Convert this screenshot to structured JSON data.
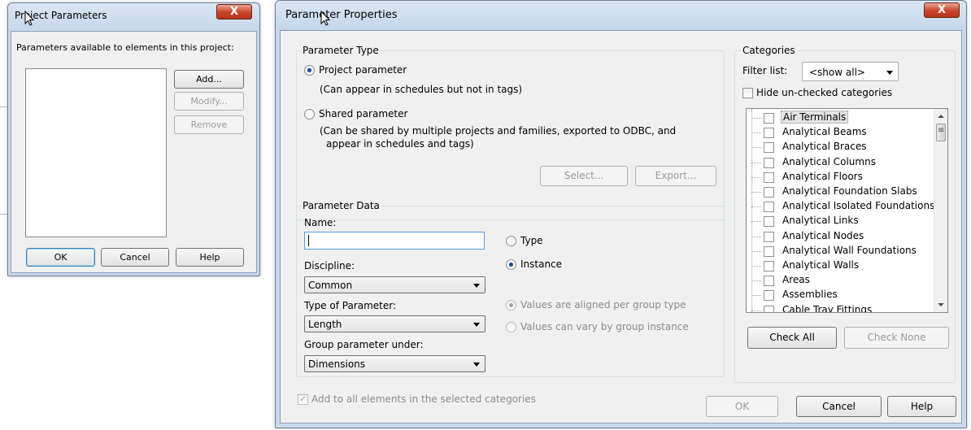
{
  "project_parameters_dialog": {
    "title": "Project Parameters",
    "close_symbol": "X",
    "description": "Parameters available to elements in this project:",
    "add_label": "Add...",
    "modify_label": "Modify...",
    "remove_label": "Remove",
    "ok_label": "OK",
    "cancel_label": "Cancel",
    "help_label": "Help"
  },
  "parameter_properties_dialog": {
    "title": "Parameter Properties",
    "close_symbol": "X",
    "parameter_type": {
      "group_label": "Parameter Type",
      "project_parameter_label": "Project parameter",
      "project_parameter_note": "(Can appear in schedules but not in tags)",
      "shared_parameter_label": "Shared parameter",
      "shared_parameter_note_line1": "(Can be shared by multiple projects and families, exported to ODBC, and",
      "shared_parameter_note_line2": "appear in schedules and tags)",
      "selected": "project",
      "select_label": "Select...",
      "export_label": "Export..."
    },
    "parameter_data": {
      "group_label": "Parameter Data",
      "name_label": "Name:",
      "name_value": "",
      "type_label": "Type",
      "instance_label": "Instance",
      "selected_binding": "instance",
      "discipline_label": "Discipline:",
      "discipline_value": "Common",
      "type_of_parameter_label": "Type of Parameter:",
      "type_of_parameter_value": "Length",
      "group_under_label": "Group parameter under:",
      "group_under_value": "Dimensions",
      "values_aligned_label": "Values are aligned per group type",
      "values_vary_label": "Values can vary by group instance"
    },
    "categories": {
      "group_label": "Categories",
      "filter_label": "Filter list:",
      "filter_value": "<show all>",
      "hide_unchecked_label": "Hide un-checked categories",
      "items": [
        "Air Terminals",
        "Analytical Beams",
        "Analytical Braces",
        "Analytical Columns",
        "Analytical Floors",
        "Analytical Foundation Slabs",
        "Analytical Isolated Foundations",
        "Analytical Links",
        "Analytical Nodes",
        "Analytical Wall Foundations",
        "Analytical Walls",
        "Areas",
        "Assemblies",
        "Cable Tray Fittings"
      ],
      "check_all_label": "Check All",
      "check_none_label": "Check None"
    },
    "add_to_all_label": "Add to all elements in the selected categories",
    "ok_label": "OK",
    "cancel_label": "Cancel",
    "help_label": "Help"
  },
  "colors": {
    "window_frame": "#c9d9ec",
    "dialog_background": "#f0f0f0",
    "close_button": "#c7432a",
    "radio_selected": "#1f4e9a"
  }
}
